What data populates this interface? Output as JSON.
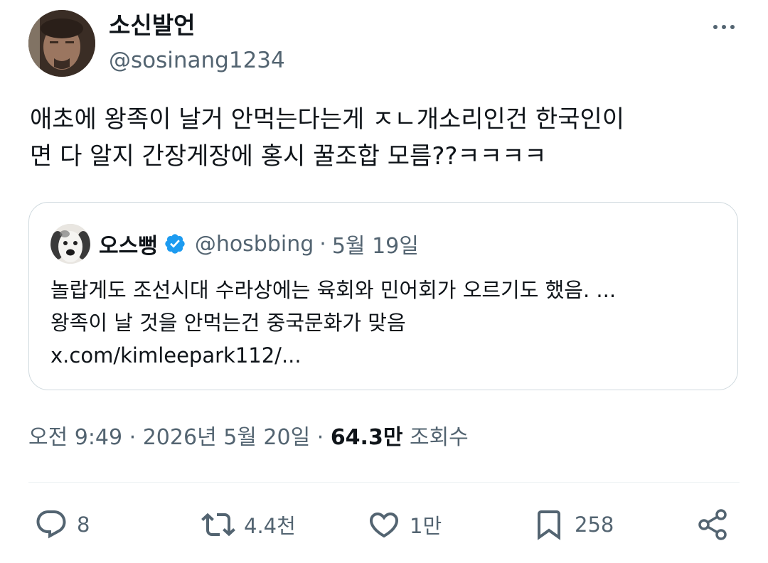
{
  "author": {
    "name": "소신발언",
    "handle": "@sosinang1234"
  },
  "tweet": {
    "text": "애초에 왕족이 날거 안먹는다는게 ㅈㄴ개소리인건 한국인이\n면 다 알지 간장게장에 홍시 꿀조합 모름??ㅋㅋㅋㅋ"
  },
  "quote": {
    "name": "오스뻥",
    "handle": "@hosbbing",
    "separator": "·",
    "date": "5월 19일",
    "text": "놀랍게도 조선시대 수라상에는 육회와 민어회가 오르기도 했음. ...\n왕족이 날 것을 안먹는건 중국문화가 맞음",
    "link": "x.com/kimleepark112/..."
  },
  "meta": {
    "time": "오전 9:49",
    "sep1": " · ",
    "date": "2026년 5월 20일",
    "sep2": " · ",
    "views": "64.3만",
    "views_label": " 조회수"
  },
  "actions": {
    "replies": "8",
    "reposts": "4.4천",
    "likes": "1만",
    "bookmarks": "258"
  },
  "icons": {
    "more": "more-horizontal-icon",
    "verified": "verified-badge-icon",
    "reply": "reply-icon",
    "repost": "repost-icon",
    "like": "heart-icon",
    "bookmark": "bookmark-icon",
    "share": "share-icon"
  },
  "colors": {
    "text": "#0f1419",
    "secondary": "#536471",
    "verified": "#1d9bf0",
    "border": "#cfd9de"
  }
}
